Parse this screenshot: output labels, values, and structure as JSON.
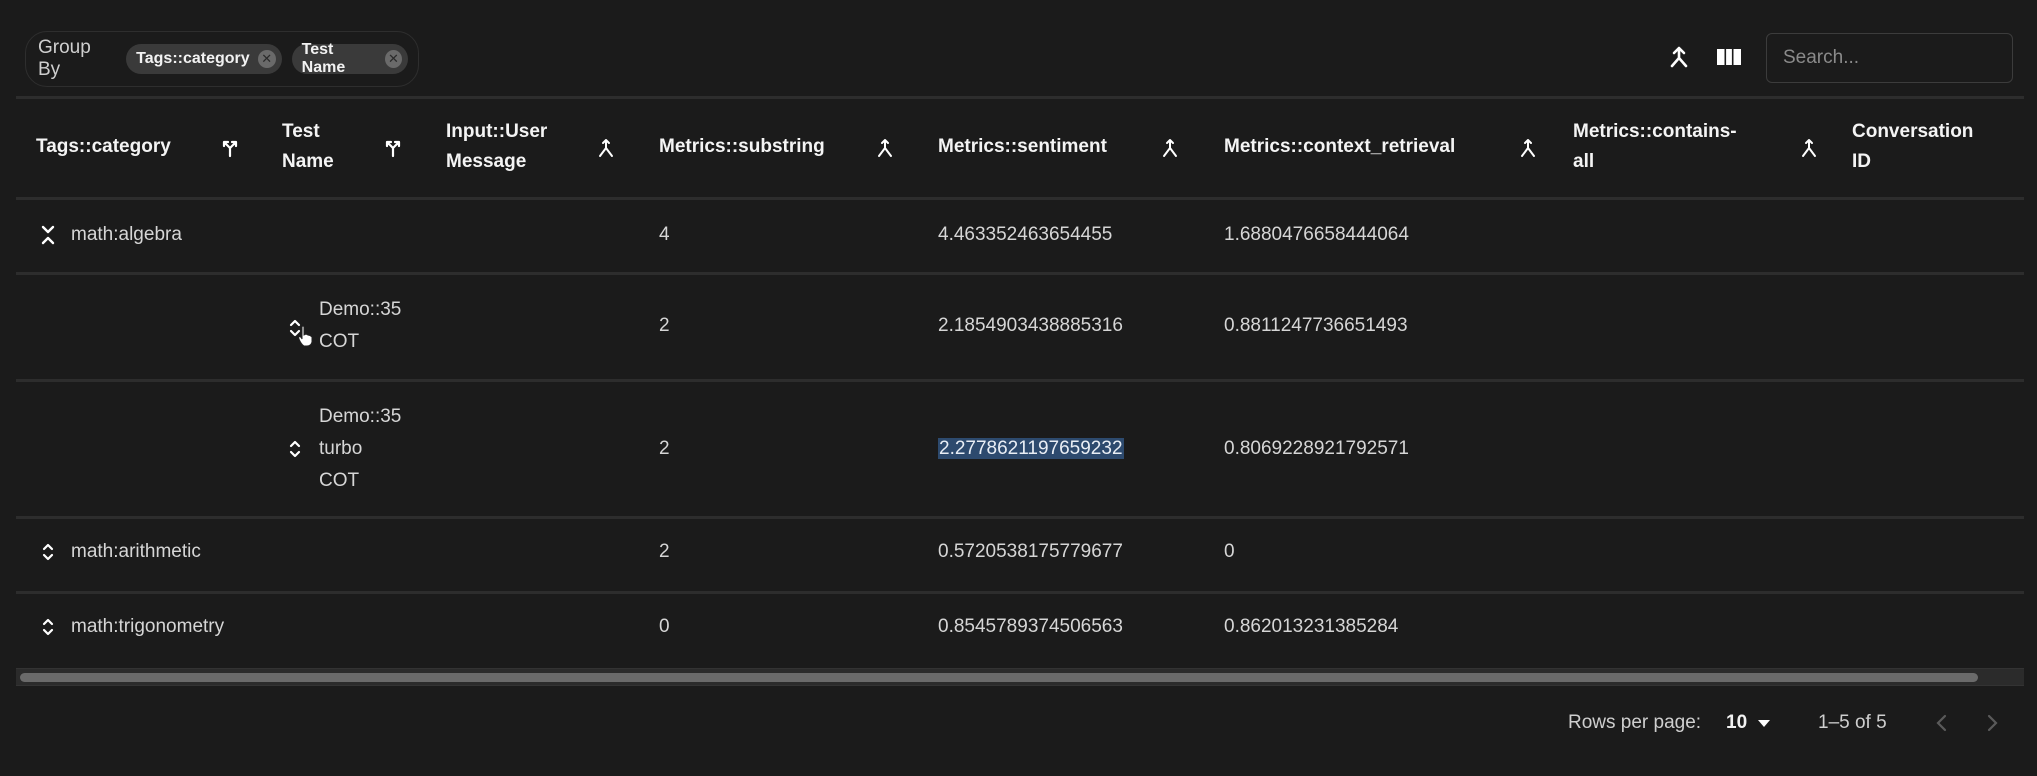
{
  "toolbar": {
    "group_by_label": "Group By",
    "group_by_chips": [
      "Tags::category",
      "Test Name"
    ],
    "merge_icon": "merge-icon",
    "columns_icon": "view-columns-icon",
    "search_placeholder": "Search...",
    "search_value": ""
  },
  "table": {
    "columns": [
      {
        "label_lines": [
          "Tags::category"
        ],
        "icon": "ungroup-icon"
      },
      {
        "label_lines": [
          "Test",
          "Name"
        ],
        "icon": "ungroup-icon"
      },
      {
        "label_lines": [
          "Input::User",
          "Message"
        ],
        "icon": "group-icon"
      },
      {
        "label_lines": [
          "Metrics::substring"
        ],
        "icon": "group-icon"
      },
      {
        "label_lines": [
          "Metrics::sentiment"
        ],
        "icon": "group-icon"
      },
      {
        "label_lines": [
          "Metrics::context_retrieval"
        ],
        "icon": "group-icon"
      },
      {
        "label_lines": [
          "Metrics::contains-",
          "all"
        ],
        "icon": "group-icon"
      },
      {
        "label_lines": [
          "Conversation",
          "ID"
        ],
        "icon": ""
      }
    ],
    "rows": [
      {
        "level": 0,
        "expanded": true,
        "group_value_lines": [
          "math:algebra"
        ],
        "substring": "4",
        "sentiment": "4.463352463654455",
        "context_retrieval": "1.6880476658444064",
        "selected_cell": ""
      },
      {
        "level": 1,
        "expanded": false,
        "group_value_lines": [
          "Demo::35",
          "COT"
        ],
        "substring": "2",
        "sentiment": "2.1854903438885316",
        "context_retrieval": "0.8811247736651493",
        "selected_cell": ""
      },
      {
        "level": 1,
        "expanded": false,
        "group_value_lines": [
          "Demo::35",
          "turbo",
          "COT"
        ],
        "substring": "2",
        "sentiment": "2.2778621197659232",
        "context_retrieval": "0.8069228921792571",
        "selected_cell": "sentiment"
      },
      {
        "level": 0,
        "expanded": false,
        "group_value_lines": [
          "math:arithmetic"
        ],
        "substring": "2",
        "sentiment": "0.5720538175779677",
        "context_retrieval": "0",
        "selected_cell": ""
      },
      {
        "level": 0,
        "expanded": false,
        "group_value_lines": [
          "math:trigonometry"
        ],
        "substring": "0",
        "sentiment": "0.8545789374506563",
        "context_retrieval": "0.862013231385284",
        "selected_cell": ""
      }
    ]
  },
  "pagination": {
    "rows_per_page_label": "Rows per page:",
    "rows_per_page_value": "10",
    "range_text": "1–5 of 5",
    "prev_enabled": false,
    "next_enabled": false
  },
  "colors": {
    "background": "#1b1b1b",
    "selection": "#2d4a6e",
    "chip": "#3a3a3a",
    "divider": "#2d2d2d"
  }
}
